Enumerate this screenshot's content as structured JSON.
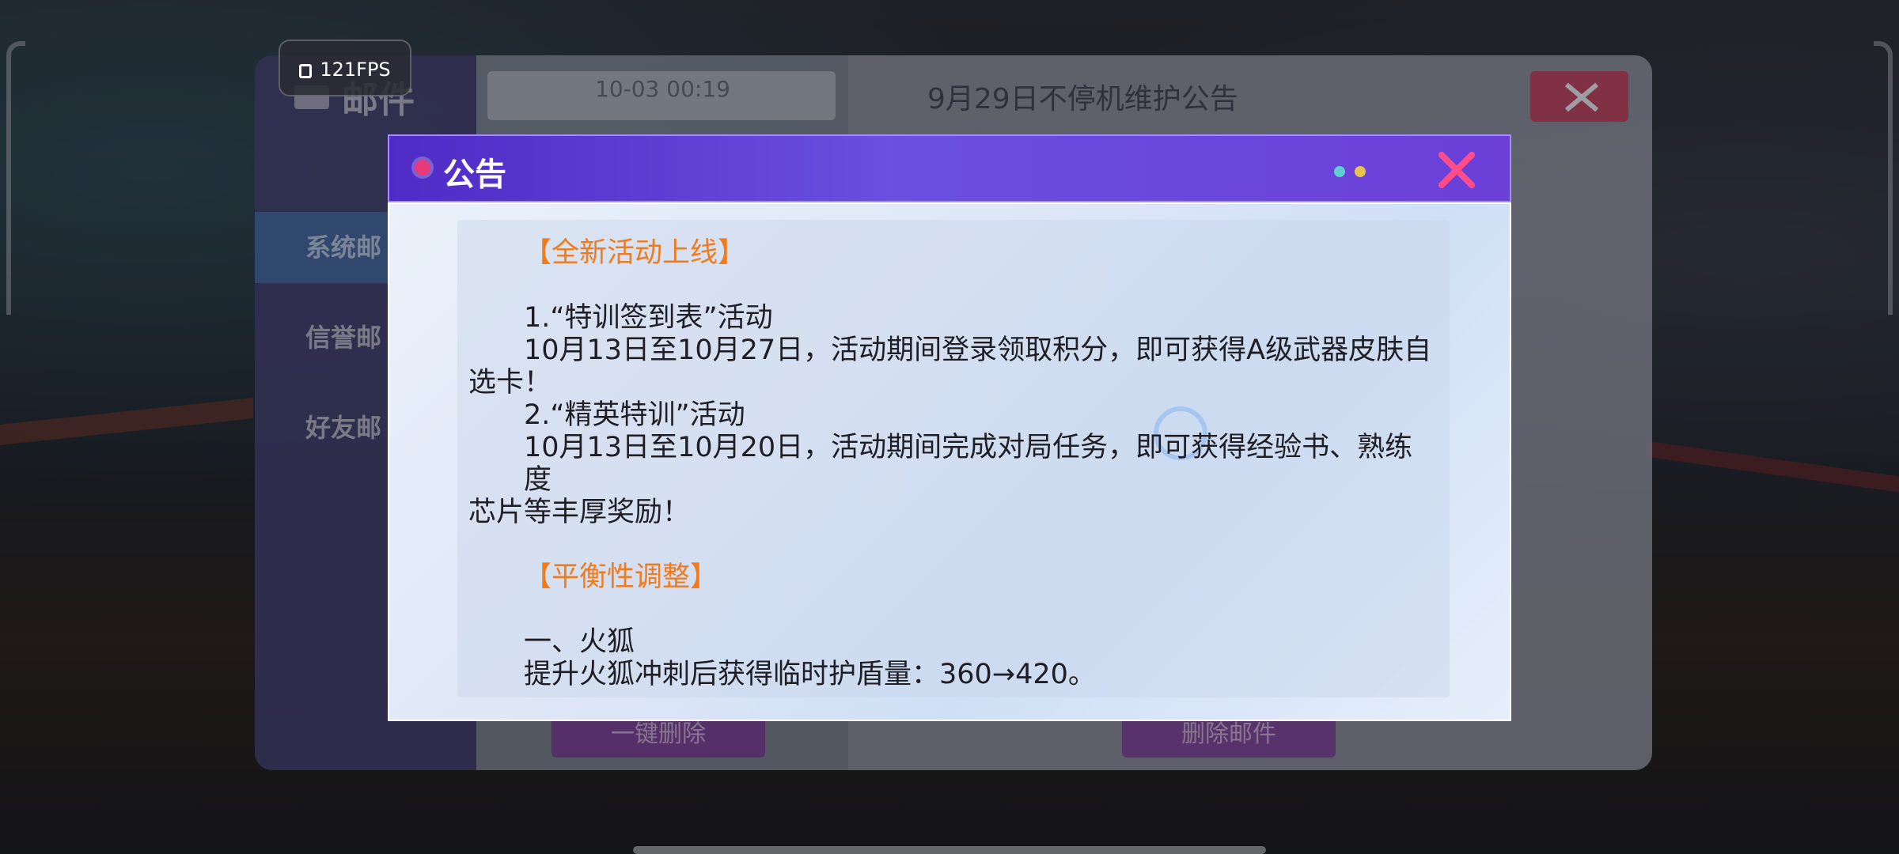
{
  "hud": {
    "fps": "121FPS"
  },
  "mail": {
    "title": "邮件",
    "tabs": [
      "系统邮",
      "信誉邮",
      "好友邮"
    ],
    "list_item_time": "10-03 00:19",
    "subject": "9月29日不停机维护公告",
    "delete_all_label": "一键删除",
    "delete_label": "删除邮件"
  },
  "dialog": {
    "title": "公告",
    "lines": {
      "h1": "【全新活动上线】",
      "a1": "1.“特训签到表”活动",
      "a1d1": "10月13日至10月27日，活动期间登录领取积分，即可获得A级武器皮肤自",
      "a1d2": "选卡！",
      "a2": "2.“精英特训”活动",
      "a2d1": "10月13日至10月20日，活动期间完成对局任务，即可获得经验书、熟练度",
      "a2d2": "芯片等丰厚奖励！",
      "h2": "【平衡性调整】",
      "b1": "一、火狐",
      "b1d": "提升火狐冲刺后获得临时护盾量：360→420。"
    }
  },
  "colors": {
    "accent_orange": "#f07b1c",
    "header_purple": "#5a38d2",
    "close_pink": "#ff4d8a"
  }
}
